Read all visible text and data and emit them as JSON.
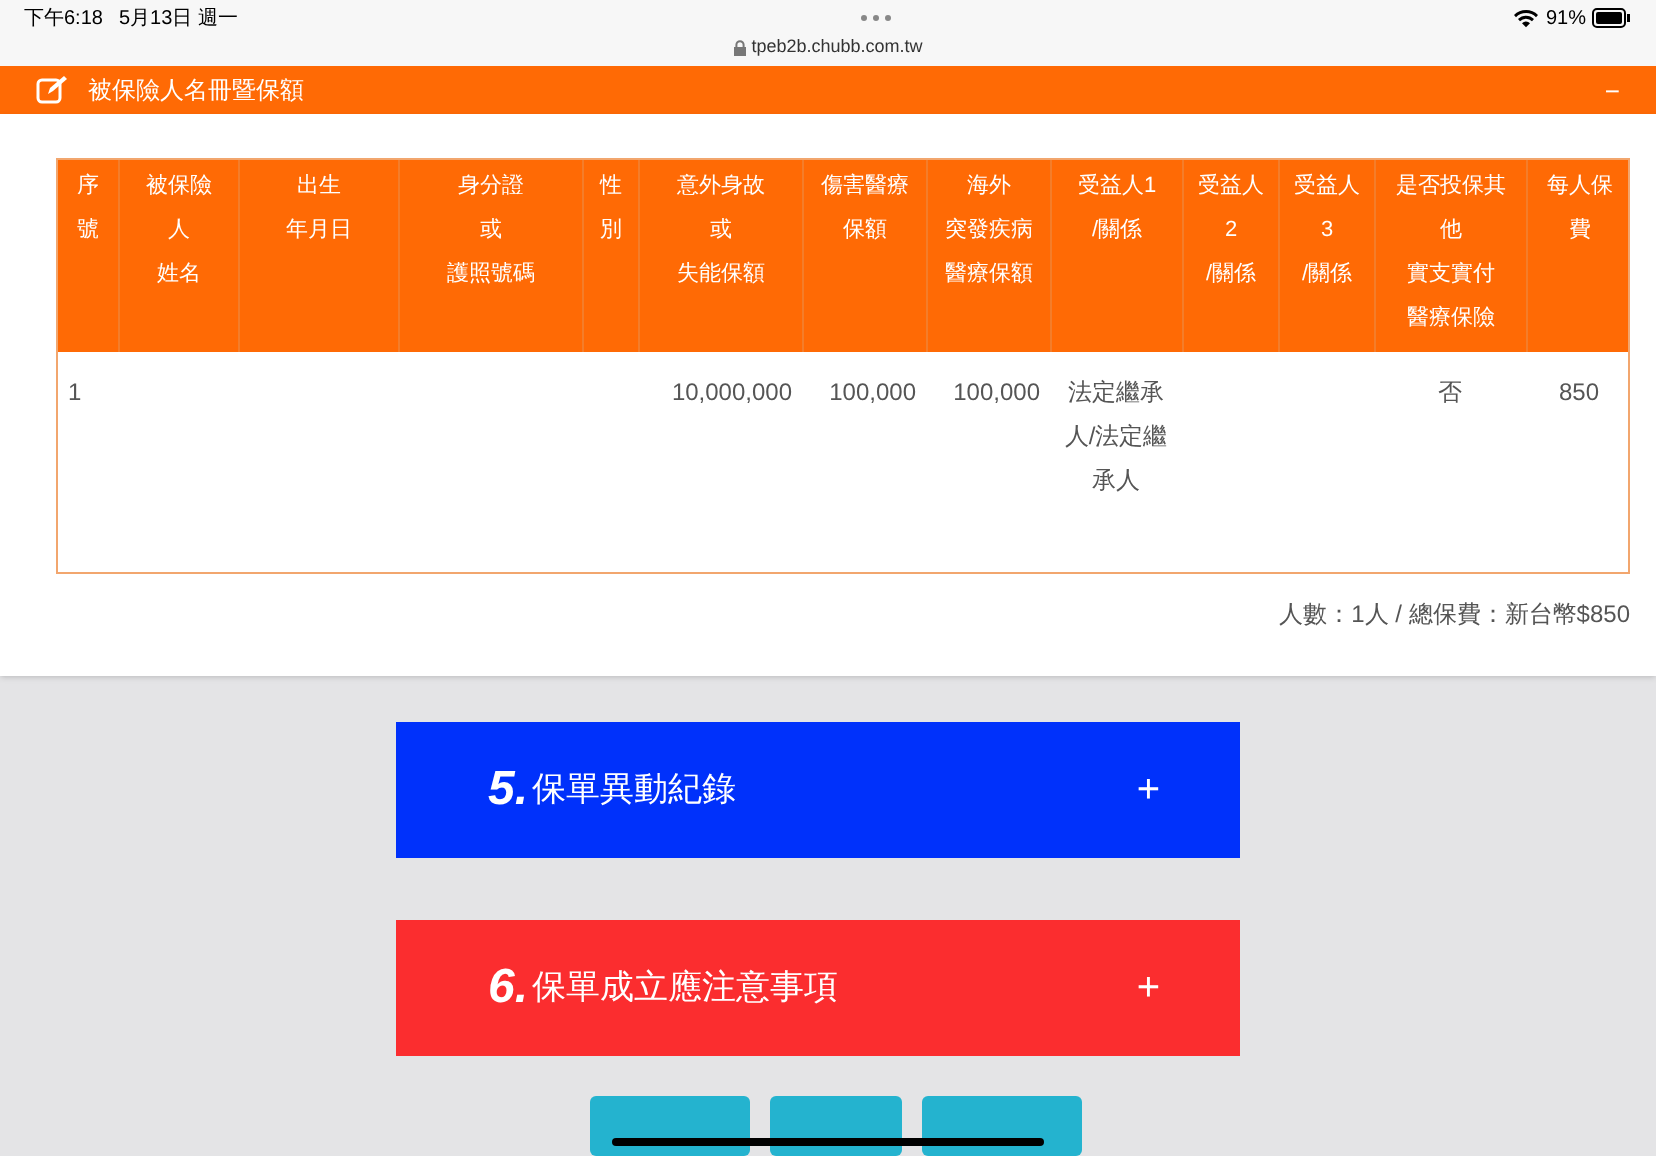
{
  "status_bar": {
    "time": "下午6:18",
    "date": "5月13日 週一",
    "battery": "91%"
  },
  "address_bar": {
    "url": "tpeb2b.chubb.com.tw"
  },
  "panel": {
    "title": "被保險人名冊暨保額",
    "collapse": "−"
  },
  "table": {
    "columns": [
      {
        "lines": [
          "序",
          "號"
        ]
      },
      {
        "lines": [
          "被保險",
          "人",
          "姓名"
        ]
      },
      {
        "lines": [
          "出生",
          "年月日"
        ]
      },
      {
        "lines": [
          "身分證",
          "或",
          "護照號碼"
        ]
      },
      {
        "lines": [
          "性",
          "別"
        ]
      },
      {
        "lines": [
          "意外身故",
          "或",
          "失能保額"
        ]
      },
      {
        "lines": [
          "傷害醫療",
          "保額"
        ]
      },
      {
        "lines": [
          "海外",
          "突發疾病",
          "醫療保額"
        ]
      },
      {
        "lines": [
          "受益人1",
          "/關係"
        ]
      },
      {
        "lines": [
          "受益人",
          "2",
          "/關係"
        ]
      },
      {
        "lines": [
          "受益人",
          "3",
          "/關係"
        ]
      },
      {
        "lines": [
          "是否投保其",
          "他",
          "實支實付",
          "醫療保險"
        ]
      },
      {
        "lines": [
          "每人保",
          "費"
        ]
      }
    ],
    "rows": [
      {
        "cells": [
          "1",
          "",
          "",
          "",
          "",
          "10,000,000",
          "100,000",
          "100,000",
          "法定繼承人/法定繼承人",
          "",
          "",
          "否",
          "850"
        ]
      }
    ]
  },
  "summary": "人數：1人 / 總保費：新台幣$850",
  "sections": [
    {
      "number": "5.",
      "title": "保單異動紀錄",
      "toggle": "+",
      "color": "#0031fb"
    },
    {
      "number": "6.",
      "title": "保單成立應注意事項",
      "toggle": "+",
      "color": "#fb2d2f"
    }
  ],
  "buttons": [
    {
      "kind": "nav"
    },
    {
      "kind": "nav"
    },
    {
      "kind": "nav"
    }
  ]
}
